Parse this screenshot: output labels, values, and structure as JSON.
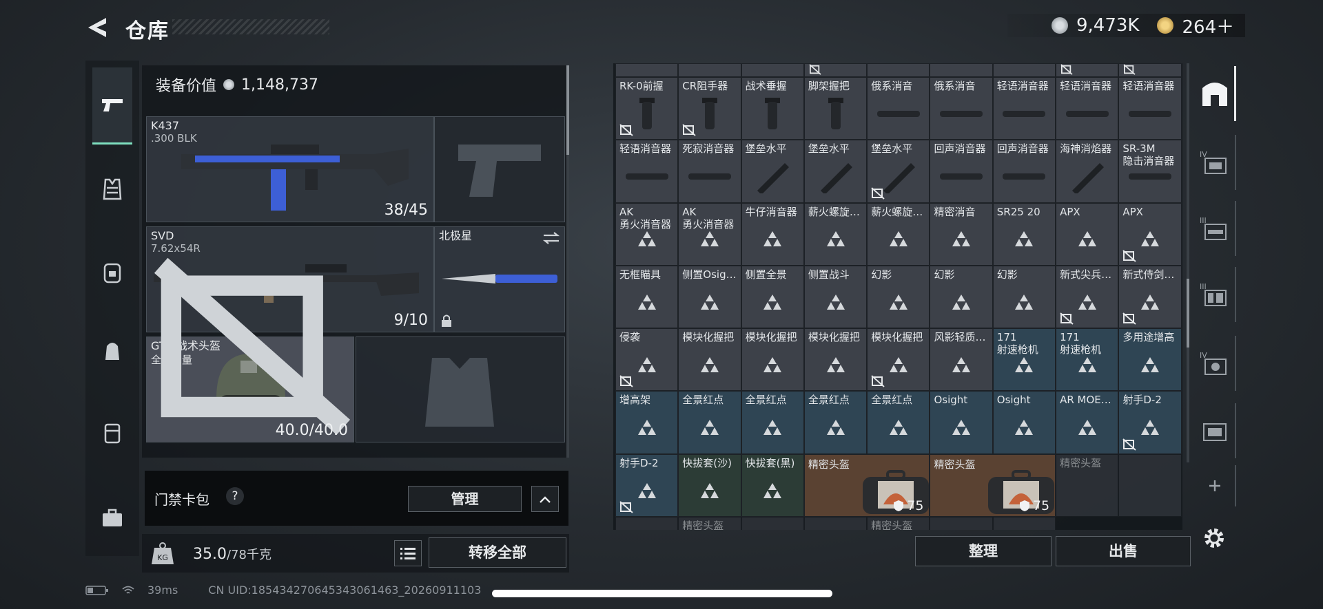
{
  "header": {
    "title": "仓库"
  },
  "currency": [
    {
      "icon": "silver-coin-icon",
      "value": "9,473K"
    },
    {
      "icon": "gold-coin-icon",
      "value": "264＋"
    }
  ],
  "loadout": {
    "value_label": "装备价值",
    "value": "1,148,737",
    "primary": {
      "name": "K437",
      "sub": ".300 BLK",
      "ammo": "38/45"
    },
    "secondary": {
      "name": "SVD",
      "sub": "7.62x54R",
      "ammo": "9/10"
    },
    "melee": {
      "name": "北极星"
    },
    "helmet": {
      "name": "GT1 战术头盔",
      "sub": "全球力量",
      "durability": "40.0/40.0"
    }
  },
  "keycard": {
    "label": "门禁卡包",
    "help": "?",
    "manage": "管理"
  },
  "weight": {
    "current": "35.0",
    "max": "/78千克",
    "transfer": "转移全部"
  },
  "status": {
    "ping": "39ms",
    "uid": "CN UID:185434270645343061463_20260911103"
  },
  "grid": {
    "cells": [
      {
        "label": "",
        "type": "top"
      },
      {
        "label": "",
        "type": "top"
      },
      {
        "label": "",
        "type": "top"
      },
      {
        "label": "",
        "type": "top",
        "lock": true
      },
      {
        "label": "",
        "type": "top"
      },
      {
        "label": "",
        "type": "top"
      },
      {
        "label": "",
        "type": "top"
      },
      {
        "label": "",
        "type": "top",
        "lock": true
      },
      {
        "label": "",
        "type": "top",
        "lock": true
      },
      {
        "label": "RK-0前握",
        "icon": "grip",
        "lock": true
      },
      {
        "label": "CR阻手器",
        "icon": "grip",
        "lock": true
      },
      {
        "label": "战术垂握",
        "icon": "grip"
      },
      {
        "label": "脚架握把",
        "icon": "grip"
      },
      {
        "label": "俄系消音",
        "icon": "sup"
      },
      {
        "label": "俄系消音",
        "icon": "sup"
      },
      {
        "label": "轻语消音器",
        "icon": "sup"
      },
      {
        "label": "轻语消音器",
        "icon": "sup"
      },
      {
        "label": "轻语消音器",
        "icon": "sup"
      },
      {
        "label": "轻语消音器",
        "icon": "sup"
      },
      {
        "label": "死寂消音器",
        "icon": "sup"
      },
      {
        "label": "堡垒水平",
        "icon": "diag"
      },
      {
        "label": "堡垒水平",
        "icon": "diag"
      },
      {
        "label": "堡垒水平",
        "icon": "diag",
        "lock": true
      },
      {
        "label": "回声消音器",
        "icon": "sup"
      },
      {
        "label": "回声消音器",
        "icon": "sup"
      },
      {
        "label": "海神消焰器",
        "icon": "diag"
      },
      {
        "label": "SR-3M\n隐击消音器",
        "icon": "sup"
      },
      {
        "label": "AK\n勇火消音器",
        "icon": "tri"
      },
      {
        "label": "AK\n勇火消音器",
        "icon": "tri"
      },
      {
        "label": "牛仔消音器",
        "icon": "tri"
      },
      {
        "label": "薪火螺旋…",
        "icon": "tri"
      },
      {
        "label": "薪火螺旋…",
        "icon": "tri"
      },
      {
        "label": "精密消音",
        "icon": "tri"
      },
      {
        "label": "SR25 20",
        "icon": "tri"
      },
      {
        "label": "APX",
        "icon": "tri"
      },
      {
        "label": "APX",
        "icon": "tri",
        "lock": true
      },
      {
        "label": "无框瞄具",
        "icon": "tri"
      },
      {
        "label": "侧置Osig…",
        "icon": "tri"
      },
      {
        "label": "侧置全景",
        "icon": "tri"
      },
      {
        "label": "侧置战斗",
        "icon": "tri"
      },
      {
        "label": "幻影",
        "icon": "tri"
      },
      {
        "label": "幻影",
        "icon": "tri"
      },
      {
        "label": "幻影",
        "icon": "tri"
      },
      {
        "label": "新式尖兵…",
        "icon": "tri",
        "lock": true
      },
      {
        "label": "新式侍剑…",
        "icon": "tri",
        "lock": true
      },
      {
        "label": "侵袭",
        "icon": "tri",
        "lock": true
      },
      {
        "label": "模块化握把",
        "icon": "tri"
      },
      {
        "label": "模块化握把",
        "icon": "tri"
      },
      {
        "label": "模块化握把",
        "icon": "tri"
      },
      {
        "label": "模块化握把",
        "icon": "tri",
        "lock": true
      },
      {
        "label": "风影轻质…",
        "icon": "tri"
      },
      {
        "label": "171\n射速枪机",
        "icon": "tri",
        "bg": "blue"
      },
      {
        "label": "171\n射速枪机",
        "icon": "tri",
        "bg": "blue"
      },
      {
        "label": "多用途增高",
        "icon": "tri",
        "bg": "blue"
      },
      {
        "label": "增高架",
        "icon": "tri",
        "bg": "blue"
      },
      {
        "label": "全景红点",
        "icon": "tri",
        "bg": "blue"
      },
      {
        "label": "全景红点",
        "icon": "tri",
        "bg": "blue"
      },
      {
        "label": "全景红点",
        "icon": "tri",
        "bg": "blue"
      },
      {
        "label": "全景红点",
        "icon": "tri",
        "bg": "blue"
      },
      {
        "label": "Osight",
        "icon": "tri",
        "bg": "blue"
      },
      {
        "label": "Osight",
        "icon": "tri",
        "bg": "blue"
      },
      {
        "label": "AR MOE…",
        "icon": "tri",
        "bg": "blue"
      },
      {
        "label": "射手D-2",
        "icon": "tri",
        "bg": "blue",
        "lock": true
      }
    ],
    "last_row": [
      {
        "label": "射手D-2",
        "icon": "tri",
        "bg": "blue",
        "lock": true
      },
      {
        "label": "快拔套(沙)",
        "icon": "tri",
        "bg": "green"
      },
      {
        "label": "快拔套(黑)",
        "icon": "tri",
        "bg": "green"
      },
      {
        "label": "精密头盔",
        "big": true,
        "armor": "75"
      },
      {
        "label": "精密头盔",
        "big": true,
        "armor": "75"
      }
    ],
    "partial_row": [
      "精密头盔",
      "",
      "",
      "精密头盔",
      "",
      "",
      "精密头盔",
      "",
      ""
    ]
  },
  "actions": {
    "sort": "整理",
    "sell": "出售"
  },
  "tabs": [
    "all-items-tab",
    "tier-4-tab",
    "tier-3-tab",
    "tier-3-tab-2",
    "tier-4-tab-2",
    "misc-tab",
    "add-tab"
  ]
}
